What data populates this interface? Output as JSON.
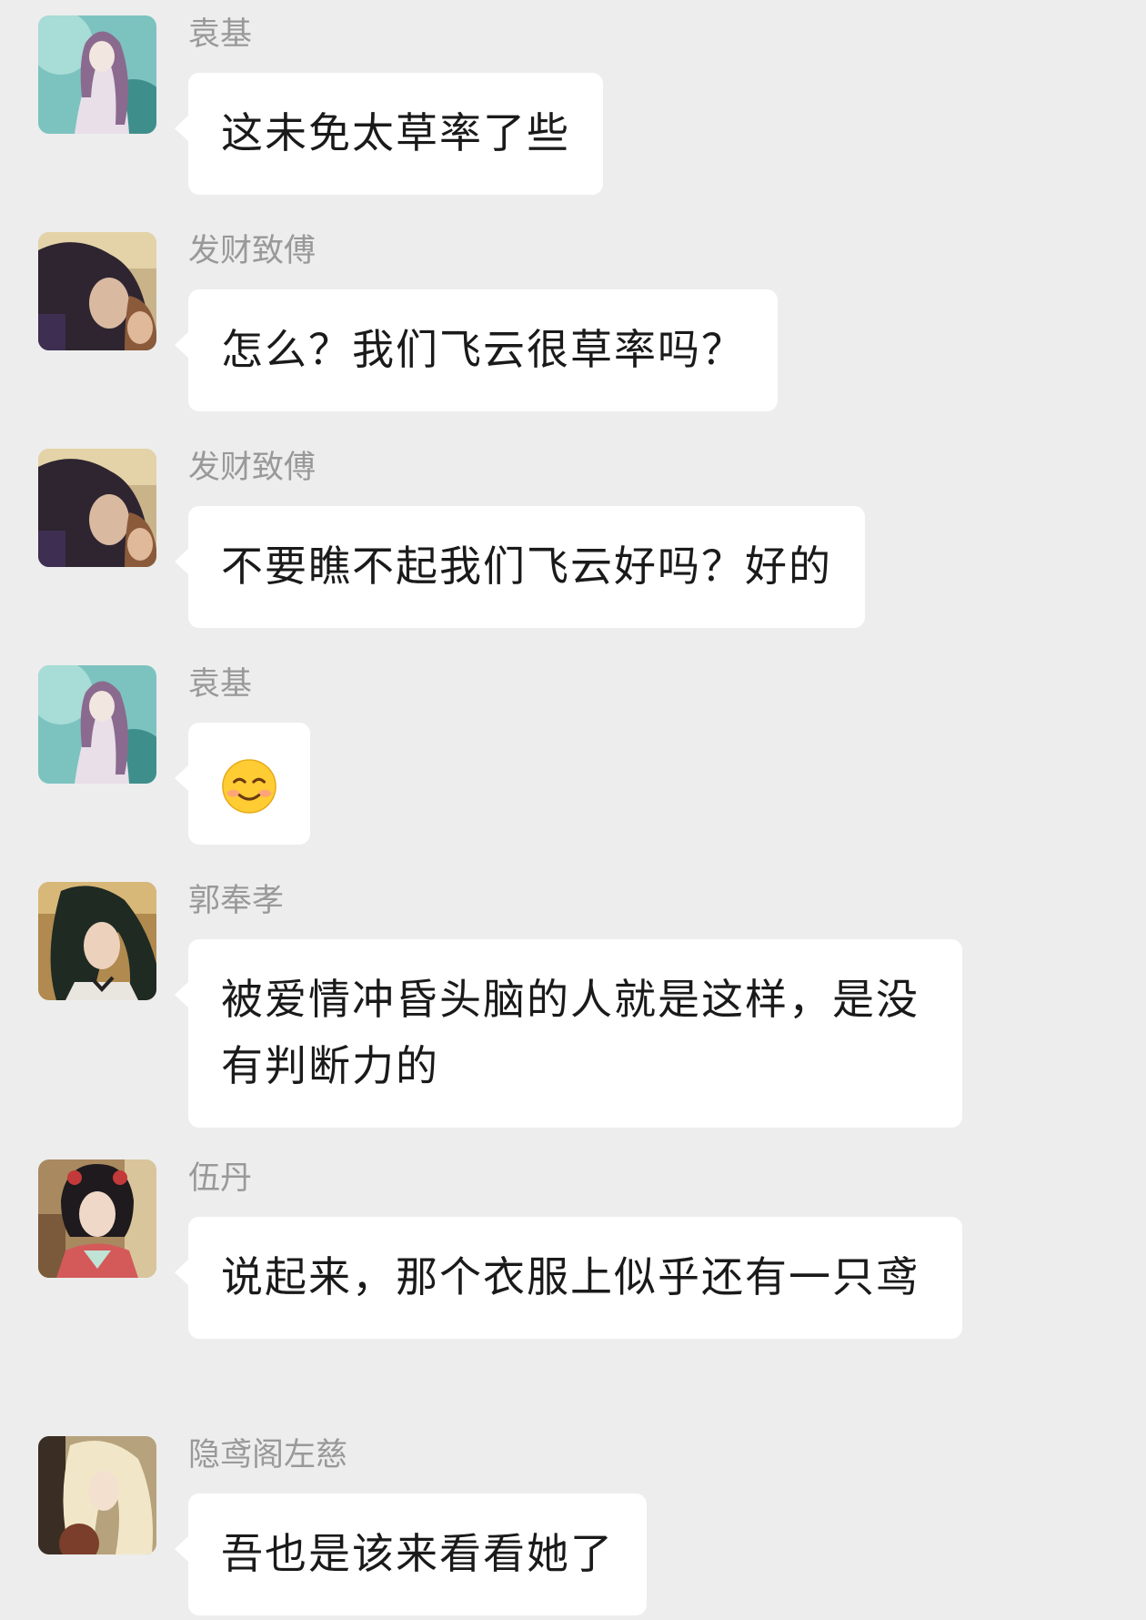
{
  "messages": [
    {
      "sender": "袁基",
      "text": "这未免太草率了些",
      "avatar": "avatar-yuanji"
    },
    {
      "sender": "发财致傅",
      "text": "怎么？我们飞云很草率吗？",
      "avatar": "avatar-facaizhifu"
    },
    {
      "sender": "发财致傅",
      "text": "不要瞧不起我们飞云好吗？好的",
      "avatar": "avatar-facaizhifu"
    },
    {
      "sender": "袁基",
      "text": "",
      "emoji": "smiling-face-emoji",
      "avatar": "avatar-yuanji"
    },
    {
      "sender": "郭奉孝",
      "text": "被爱情冲昏头脑的人就是这样，是没有判断力的",
      "avatar": "avatar-guofengxiao"
    },
    {
      "sender": "伍丹",
      "text": "说起来，那个衣服上似乎还有一只鸢",
      "avatar": "avatar-wudan"
    },
    {
      "sender": "隐鸢阁左慈",
      "text": "吾也是该来看看她了",
      "avatar": "avatar-zuoci"
    }
  ],
  "colors": {
    "background": "#ededed",
    "bubble": "#ffffff",
    "sender_name": "#999999",
    "message_text": "#1a1a1a"
  }
}
